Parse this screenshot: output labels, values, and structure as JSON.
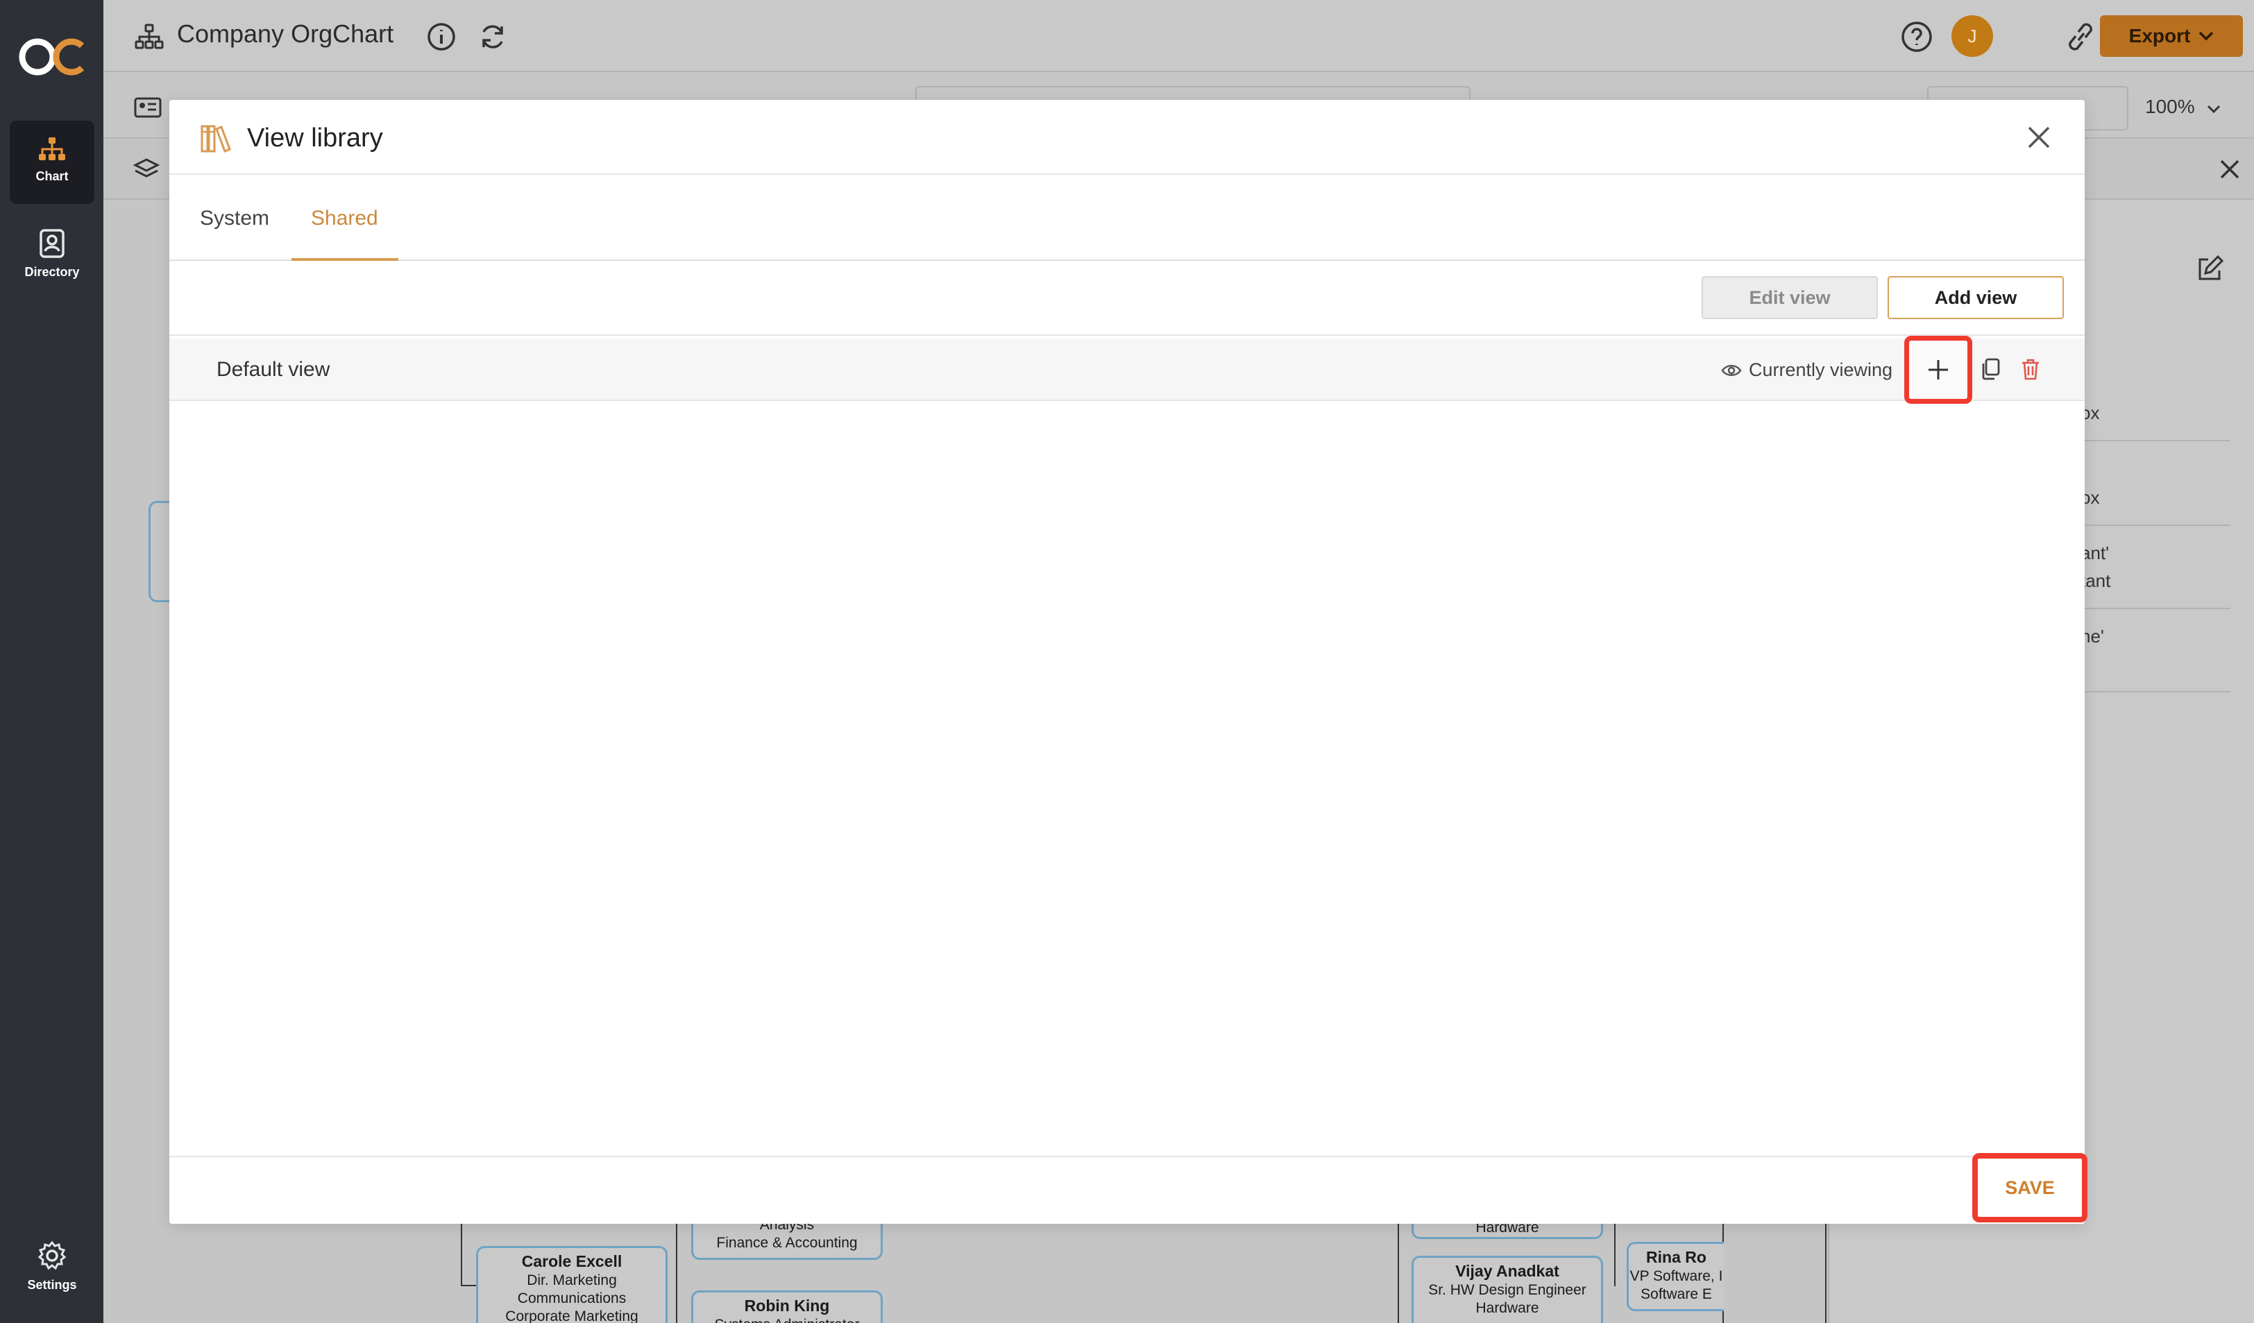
{
  "app": {
    "title": "Company OrgChart",
    "export_label": "Export",
    "avatar_initial": "J",
    "zoom": "100%"
  },
  "rail": {
    "items": [
      {
        "label": "Chart",
        "icon": "org-chart-icon"
      },
      {
        "label": "Directory",
        "icon": "directory-icon"
      },
      {
        "label": "Settings",
        "icon": "gear-icon"
      }
    ]
  },
  "background_panel": {
    "fragments": [
      "ox",
      "ox",
      "ant'",
      "tant",
      "ne'"
    ]
  },
  "background_cards": [
    {
      "name": "Carole Excell",
      "line1": "Dir. Marketing",
      "line2": "Communications",
      "line3": "Corporate Marketing"
    },
    {
      "name": "",
      "line1": "Analysis",
      "line2": "Finance & Accounting",
      "line3": ""
    },
    {
      "name": "Robin King",
      "line1": "Systems Administrator",
      "line2": "",
      "line3": ""
    },
    {
      "name": "",
      "line1": "Hardware",
      "line2": "",
      "line3": ""
    },
    {
      "name": "Vijay Anadkat",
      "line1": "Sr. HW Design Engineer",
      "line2": "Hardware",
      "line3": ""
    },
    {
      "name": "Rina Ro",
      "line1": "VP Software, I",
      "line2": "Software E",
      "line3": ""
    }
  ],
  "modal": {
    "title": "View library",
    "tabs": [
      {
        "label": "System",
        "active": false
      },
      {
        "label": "Shared",
        "active": true
      }
    ],
    "edit_view_label": "Edit view",
    "add_view_label": "Add view",
    "views": [
      {
        "name": "Default view",
        "status": "Currently viewing"
      }
    ],
    "save_label": "SAVE"
  },
  "colors": {
    "accent": "#d89a50",
    "highlight": "#f03a2e",
    "rail": "#2e3038"
  }
}
